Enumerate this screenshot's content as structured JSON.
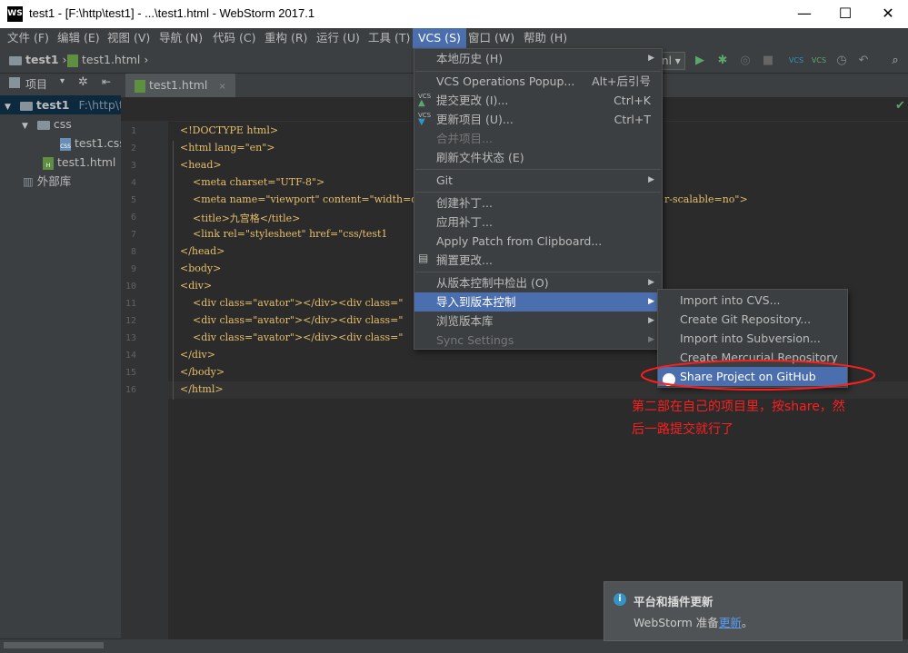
{
  "window": {
    "title": "test1 - [F:\\http\\test1] - ...\\test1.html - WebStorm 2017.1",
    "app_icon": "WS",
    "minimize": "—",
    "maximize": "☐",
    "close": "✕"
  },
  "menubar": {
    "items": [
      {
        "label": "文件 (F)"
      },
      {
        "label": "编辑 (E)"
      },
      {
        "label": "视图 (V)"
      },
      {
        "label": "导航 (N)"
      },
      {
        "label": "代码 (C)"
      },
      {
        "label": "重构 (R)"
      },
      {
        "label": "运行 (U)"
      },
      {
        "label": "工具 (T)"
      },
      {
        "label": "VCS (S)"
      },
      {
        "label": "窗口 (W)"
      },
      {
        "label": "帮助 (H)"
      }
    ]
  },
  "nav": {
    "project": "test1",
    "file": "test1.html",
    "run_config_fragment": "nl"
  },
  "project_panel": {
    "header": "项目",
    "root_name": "test1",
    "root_path": "F:\\http\\te",
    "css_folder": "css",
    "css_file": "test1.css",
    "html_file": "test1.html",
    "external_libs": "外部库"
  },
  "editor": {
    "tab": "test1.html",
    "line_numbers": [
      "1",
      "2",
      "3",
      "4",
      "5",
      "6",
      "7",
      "8",
      "9",
      "10",
      "11",
      "12",
      "13",
      "14",
      "15",
      "16"
    ],
    "lines": [
      "<!DOCTYPE html>",
      "<html lang=\"en\">",
      "<head>",
      "    <meta charset=\"UTF-8\">",
      "    <meta name=\"viewport\" content=\"width=de",
      "    <title>九宫格</title>",
      "    <link rel=\"stylesheet\" href=\"css/test1",
      "</head>",
      "<body>",
      "<div>",
      "    <div class=\"avator\"></div><div class=\"",
      "    <div class=\"avator\"></div><div class=\"",
      "    <div class=\"avator\"></div><div class=\"",
      "</div>",
      "</body>",
      "</html>"
    ],
    "line5_tail": "r-scalable=no\">"
  },
  "vcs_menu": {
    "items": [
      {
        "label": "本地历史 (H)",
        "submenu": true
      },
      {
        "label": "VCS Operations Popup...",
        "shortcut": "Alt+后引号"
      },
      {
        "label": "提交更改 (I)...",
        "shortcut": "Ctrl+K"
      },
      {
        "label": "更新项目 (U)...",
        "shortcut": "Ctrl+T"
      },
      {
        "label": "合并项目...",
        "disabled": true
      },
      {
        "label": "刷新文件状态 (E)"
      },
      {
        "label": "Git",
        "submenu": true
      },
      {
        "label": "创建补丁..."
      },
      {
        "label": "应用补丁..."
      },
      {
        "label": "Apply Patch from Clipboard..."
      },
      {
        "label": "搁置更改..."
      },
      {
        "label": "从版本控制中检出 (O)",
        "submenu": true
      },
      {
        "label": "导入到版本控制",
        "submenu": true
      },
      {
        "label": "浏览版本库",
        "submenu": true
      },
      {
        "label": "Sync Settings",
        "disabled": true,
        "submenu": true
      }
    ]
  },
  "import_submenu": {
    "items": [
      {
        "label": "Import into CVS..."
      },
      {
        "label": "Create Git Repository..."
      },
      {
        "label": "Import into Subversion..."
      },
      {
        "label": "Create Mercurial Repository"
      },
      {
        "label": "Share Project on GitHub"
      }
    ]
  },
  "annotation": {
    "line1": "第二部在自己的项目里，按share，然",
    "line2": "后一路提交就行了",
    "color": "#ff1e1e"
  },
  "notification": {
    "title": "平台和插件更新",
    "body_prefix": "WebStorm 准备",
    "link": "更新",
    "body_suffix": "。"
  },
  "colors": {
    "accent": "#4b6eaf",
    "background": "#2b2b2b",
    "panel": "#3c3f41"
  }
}
